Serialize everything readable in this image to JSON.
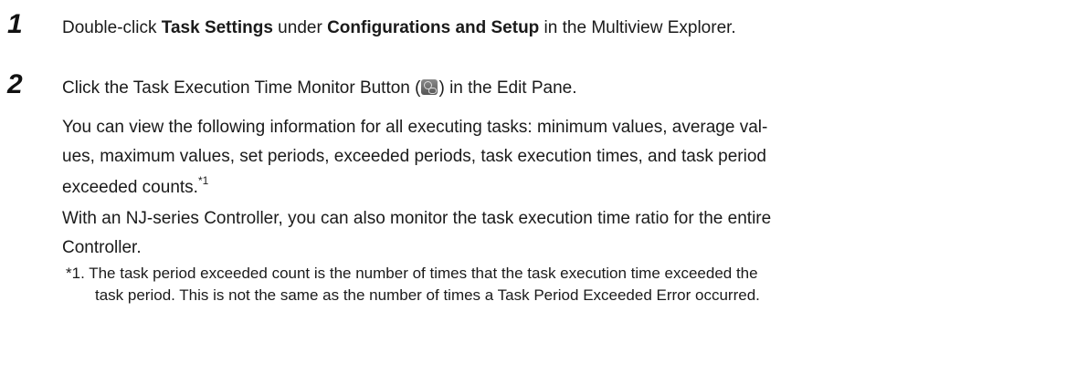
{
  "steps": [
    {
      "number": "1",
      "pre1": "Double-click ",
      "bold1": "Task Settings",
      "mid": " under ",
      "bold2": "Configurations and Setup",
      "post": " in the Multiview Explorer."
    },
    {
      "number": "2",
      "pre": "Click the Task Execution Time Monitor Button (",
      "icon": "task-execution-time-monitor-icon",
      "post": ") in the Edit Pane.",
      "para1": [
        "You can view the following information for all executing tasks: minimum values, average val-",
        "ues, maximum values, set periods, exceeded periods, task execution times, and task period",
        "exceeded counts."
      ],
      "footnote_ref": "*1",
      "para2": [
        "With an NJ-series Controller, you can also monitor the task execution time ratio for the entire",
        "Controller."
      ]
    }
  ],
  "footnote": {
    "marker": "*1.",
    "lines": [
      "The task period exceeded count is the number of times that the task execution time exceeded the",
      "task period. This is not the same as the number of times a Task Period Exceeded Error occurred."
    ]
  }
}
